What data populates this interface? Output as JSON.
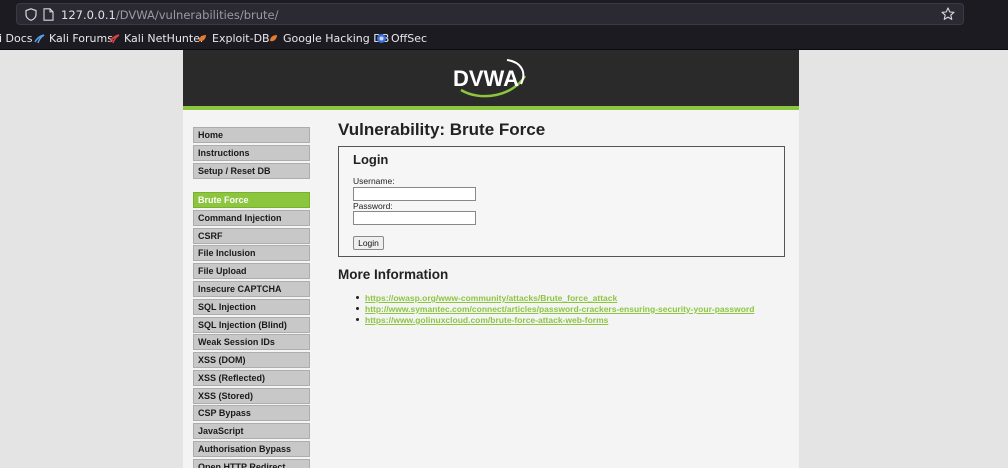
{
  "browser": {
    "url_host": "127.0.0.1",
    "url_path": "/DVWA/vulnerabilities/brute/",
    "bookmarks": [
      {
        "label": "i Docs",
        "icon": "docs-icon"
      },
      {
        "label": "Kali Forums",
        "icon": "kali-icon"
      },
      {
        "label": "Kali NetHunter",
        "icon": "nethunter-icon"
      },
      {
        "label": "Exploit-DB",
        "icon": "exploitdb-icon"
      },
      {
        "label": "Google Hacking DB",
        "icon": "ghdb-icon"
      },
      {
        "label": "OffSec",
        "icon": "offsec-icon"
      }
    ]
  },
  "header": {
    "logo_text": "DVWA"
  },
  "menu": {
    "items": [
      {
        "label": "Home"
      },
      {
        "label": "Instructions"
      },
      {
        "label": "Setup / Reset DB"
      },
      {
        "label": "Brute Force",
        "active": true
      },
      {
        "label": "Command Injection"
      },
      {
        "label": "CSRF"
      },
      {
        "label": "File Inclusion"
      },
      {
        "label": "File Upload"
      },
      {
        "label": "Insecure CAPTCHA"
      },
      {
        "label": "SQL Injection"
      },
      {
        "label": "SQL Injection (Blind)"
      },
      {
        "label": "Weak Session IDs"
      },
      {
        "label": "XSS (DOM)"
      },
      {
        "label": "XSS (Reflected)"
      },
      {
        "label": "XSS (Stored)"
      },
      {
        "label": "CSP Bypass"
      },
      {
        "label": "JavaScript"
      },
      {
        "label": "Authorisation Bypass"
      },
      {
        "label": "Open HTTP Redirect"
      }
    ]
  },
  "main": {
    "title": "Vulnerability: Brute Force",
    "login": {
      "heading": "Login",
      "username_label": "Username:",
      "username_value": "",
      "password_label": "Password:",
      "password_value": "",
      "submit_label": "Login"
    },
    "more_info_heading": "More Information",
    "links": [
      "https://owasp.org/www-community/attacks/Brute_force_attack",
      "http://www.symantec.com/connect/articles/password-crackers-ensuring-security-your-password",
      "https://www.golinuxcloud.com/brute-force-attack-web-forms"
    ]
  },
  "colors": {
    "accent": "#8cc63f",
    "header_bg": "#2a2a2a",
    "menu_bg": "#c8c8c8",
    "browser_bg": "#1c1b22"
  }
}
